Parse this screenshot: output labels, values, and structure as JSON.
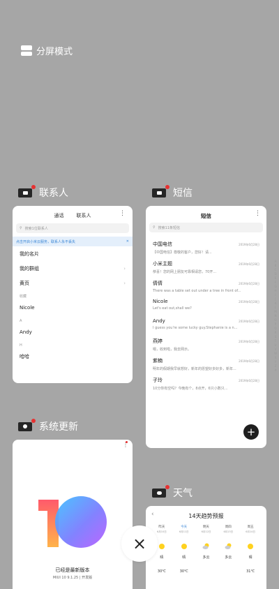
{
  "split_mode": {
    "label": "分屏模式"
  },
  "apps": {
    "contacts": {
      "label": "联系人",
      "tabs": [
        "通话",
        "联系人"
      ],
      "search_placeholder": "搜索1位联系人",
      "banner": "点击开启小米云服务，联系人永不丢失",
      "items": [
        {
          "type": "item",
          "text": "我的名片"
        },
        {
          "type": "item",
          "text": "我的群组"
        },
        {
          "type": "item",
          "text": "黄页"
        },
        {
          "type": "section",
          "text": "收藏"
        },
        {
          "type": "item",
          "text": "Nicole"
        },
        {
          "type": "section",
          "text": "A"
        },
        {
          "type": "item",
          "text": "Andy"
        },
        {
          "type": "section",
          "text": "H"
        },
        {
          "type": "item",
          "text": "哈哈"
        }
      ],
      "alphabet": "ABCDEFGHIJKLMNOPQRSTUVWXYZ#"
    },
    "sms": {
      "label": "短信",
      "title": "短信",
      "search_placeholder": "搜索11条短信",
      "messages": [
        {
          "name": "中国电信",
          "time": "2019年6月28日",
          "preview": "【中国电信】尊敬的客户，您好！请..."
        },
        {
          "name": "小米主题",
          "time": "2019年6月28日",
          "preview": "恭喜！您的网上朋友可靠相请您，70开..."
        },
        {
          "name": "倩倩",
          "time": "2019年6月28日",
          "preview": "There was a table set out under a tree in front of..."
        },
        {
          "name": "Nicole",
          "time": "2019年6月28日",
          "preview": "Let's eat out,shall we?"
        },
        {
          "name": "Andy",
          "time": "2019年6月28日",
          "preview": "I guess you're some lucky guy.Stephanie is a n..."
        },
        {
          "name": "燕婷",
          "time": "2019年6月28日",
          "preview": "嗯，收到啦，我去网示。"
        },
        {
          "name": "紫楠",
          "time": "2019年6月28日",
          "preview": "明年的假期我早就想好，新年的愿望好多好多，新年..."
        },
        {
          "name": "子玲",
          "time": "2019年6月28日",
          "preview": "10分你有空吗？今晚有个，8点开，6只小数只..."
        }
      ]
    },
    "update": {
      "label": "系统更新",
      "status": "已经是最新版本",
      "version": "MIUI 10 9.1.25 | 开发版"
    },
    "weather": {
      "label": "天气",
      "title": "14天趋势预报",
      "days": [
        {
          "day": "昨天",
          "date": "6月10日",
          "desc": "晴",
          "temp": "30℃",
          "icon": "sun"
        },
        {
          "day": "今天",
          "date": "6月11日",
          "desc": "晴",
          "temp": "30℃",
          "icon": "sun"
        },
        {
          "day": "明天",
          "date": "6月12日",
          "desc": "多云",
          "temp": "",
          "icon": "cloud-sun"
        },
        {
          "day": "周四",
          "date": "6月13日",
          "desc": "多云",
          "temp": "",
          "icon": "cloud-sun"
        },
        {
          "day": "周五",
          "date": "6月14日",
          "desc": "晴",
          "temp": "31℃",
          "icon": "sun"
        }
      ]
    }
  },
  "close_button": {
    "label": "×"
  },
  "colors": {
    "background": "#a6a6a6",
    "badge": "#e63232",
    "link": "#3a86d6"
  }
}
